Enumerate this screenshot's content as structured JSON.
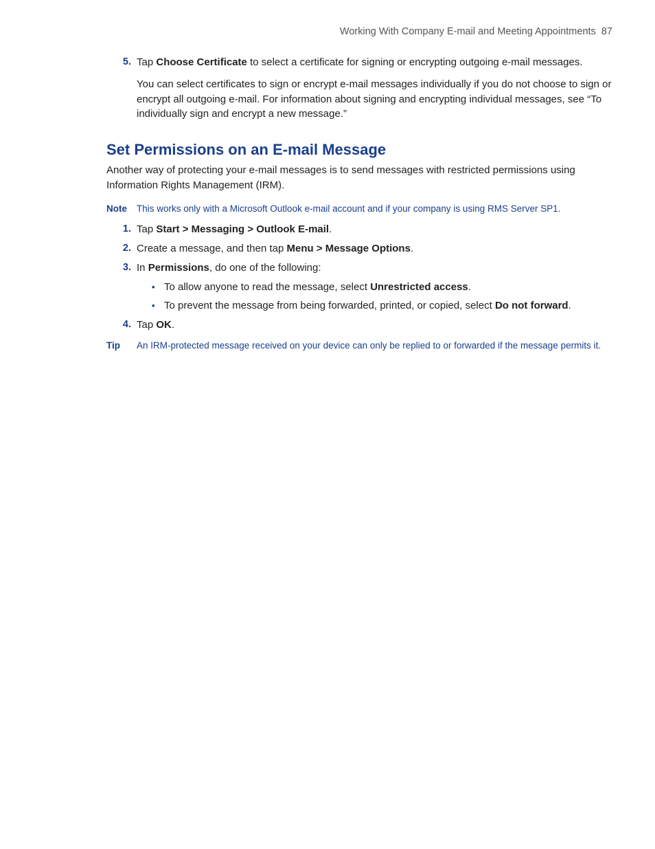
{
  "header": {
    "chapter": "Working With Company E-mail and Meeting Appointments",
    "page": "87"
  },
  "top_step": {
    "num": "5.",
    "line_pre": "Tap ",
    "line_bold": "Choose Certificate",
    "line_post": " to select a certificate for signing or encrypting outgoing e-mail messages.",
    "sub": "You can select certificates to sign or encrypt e-mail messages individually if you do not choose to sign or encrypt all outgoing e-mail. For information about signing and encrypting individual messages, see “To individually sign and encrypt a new message.”"
  },
  "heading": "Set Permissions on an E-mail Message",
  "intro": "Another way of protecting your e-mail messages is to send messages with restricted permissions using Information Rights Management (IRM).",
  "note": {
    "label": "Note",
    "text": "This works only with a Microsoft Outlook e-mail account and if your company is using RMS Server SP1."
  },
  "steps": {
    "s1": {
      "num": "1.",
      "pre": "Tap ",
      "bold": "Start > Messaging > Outlook E-mail",
      "post": "."
    },
    "s2": {
      "num": "2.",
      "pre": "Create a message, and then tap ",
      "bold": "Menu > Message Options",
      "post": "."
    },
    "s3": {
      "num": "3.",
      "pre": "In ",
      "bold": "Permissions",
      "post": ", do one of the following:"
    },
    "s4": {
      "num": "4.",
      "pre": "Tap ",
      "bold": "OK",
      "post": "."
    }
  },
  "bullets": {
    "b1": {
      "pre": "To allow anyone to read the message, select ",
      "bold": "Unrestricted access",
      "post": "."
    },
    "b2": {
      "pre": "To prevent the message from being forwarded, printed, or copied, select ",
      "bold": "Do not forward",
      "post": "."
    }
  },
  "tip": {
    "label": "Tip",
    "text": "An IRM-protected message received on your device can only be replied to or forwarded if the message permits it."
  }
}
